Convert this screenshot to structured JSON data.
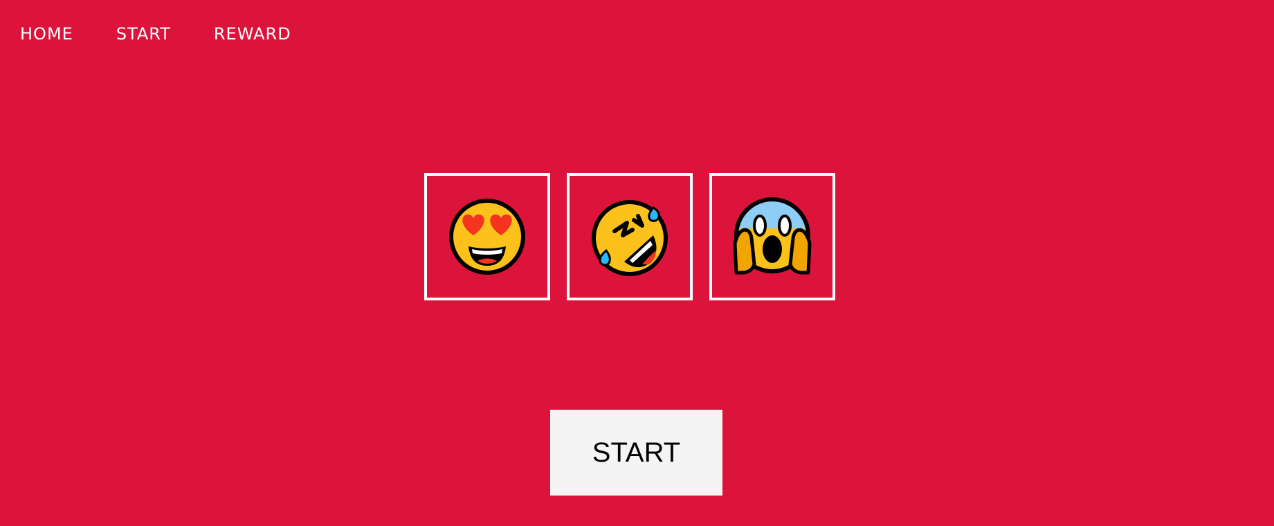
{
  "nav": {
    "items": [
      {
        "label": "HOME"
      },
      {
        "label": "START"
      },
      {
        "label": "REWARD"
      }
    ]
  },
  "slots": [
    {
      "icon": "heart-eyes-face-icon"
    },
    {
      "icon": "rolling-on-floor-laughing-face-icon"
    },
    {
      "icon": "screaming-in-fear-face-icon"
    }
  ],
  "start_button": {
    "label": "START"
  },
  "colors": {
    "background": "#dc143c",
    "slot_border": "#ffffff",
    "button_bg": "#f4f4f4",
    "face_yellow": "#fcc21b",
    "heart_red": "#f4341f",
    "tear_blue": "#29b6f6",
    "fear_blue": "#8ecdf5"
  }
}
